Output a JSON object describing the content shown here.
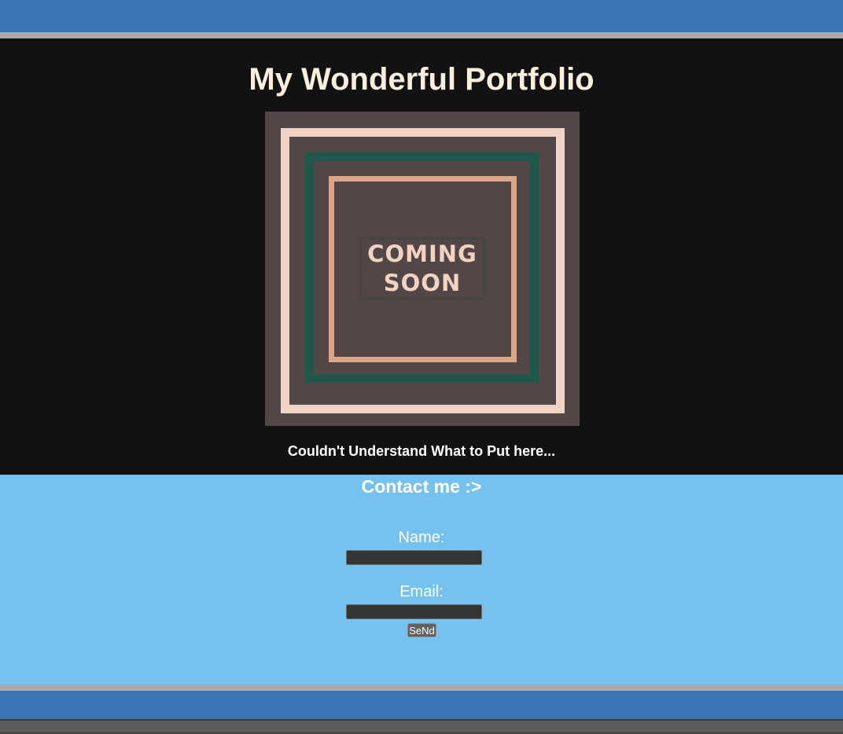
{
  "header": {
    "title": "My Wonderful Portfolio"
  },
  "hero": {
    "poster": {
      "line1": "COMING",
      "line2": "SOON"
    },
    "caption": "Couldn't Understand What to Put here..."
  },
  "contact": {
    "title": "Contact me :>",
    "name_label": "Name:",
    "name_value": "",
    "email_label": "Email:",
    "email_value": "",
    "send_label": "SeNd"
  },
  "colors": {
    "top_bar": "#3d74b6",
    "divider": "#a9a9a9",
    "hero_bg": "#121212",
    "title_text": "#fbeedd",
    "contact_bg": "#75c2f1",
    "poster_bg": "#524746",
    "poster_outer_frame": "#f0d3c3",
    "poster_middle_frame": "#20574b",
    "poster_inner_frame": "#dba78a"
  }
}
